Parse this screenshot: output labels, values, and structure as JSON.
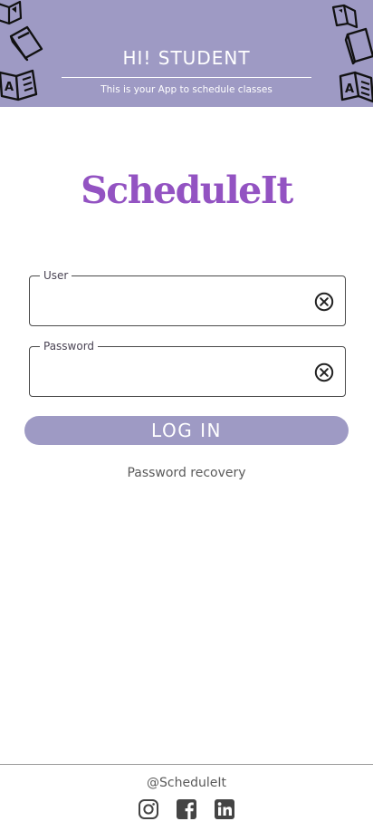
{
  "header": {
    "title": "HI! STUDENT",
    "subtitle": "This is your App to schedule classes",
    "background_color": "#9e9ac4",
    "decorations": [
      "book-icon",
      "open-book-icon",
      "abc-book-icon"
    ]
  },
  "logo": {
    "text": "ScheduleIt",
    "color": "#9353c2"
  },
  "form": {
    "user": {
      "label": "User",
      "value": "",
      "clear_icon": "clear-circle-icon"
    },
    "password": {
      "label": "Password",
      "value": "",
      "clear_icon": "clear-circle-icon"
    },
    "login_label": "LOG IN",
    "recovery_label": "Password recovery"
  },
  "footer": {
    "handle": "@ScheduleIt",
    "social": [
      "instagram-icon",
      "facebook-icon",
      "linkedin-icon"
    ]
  }
}
